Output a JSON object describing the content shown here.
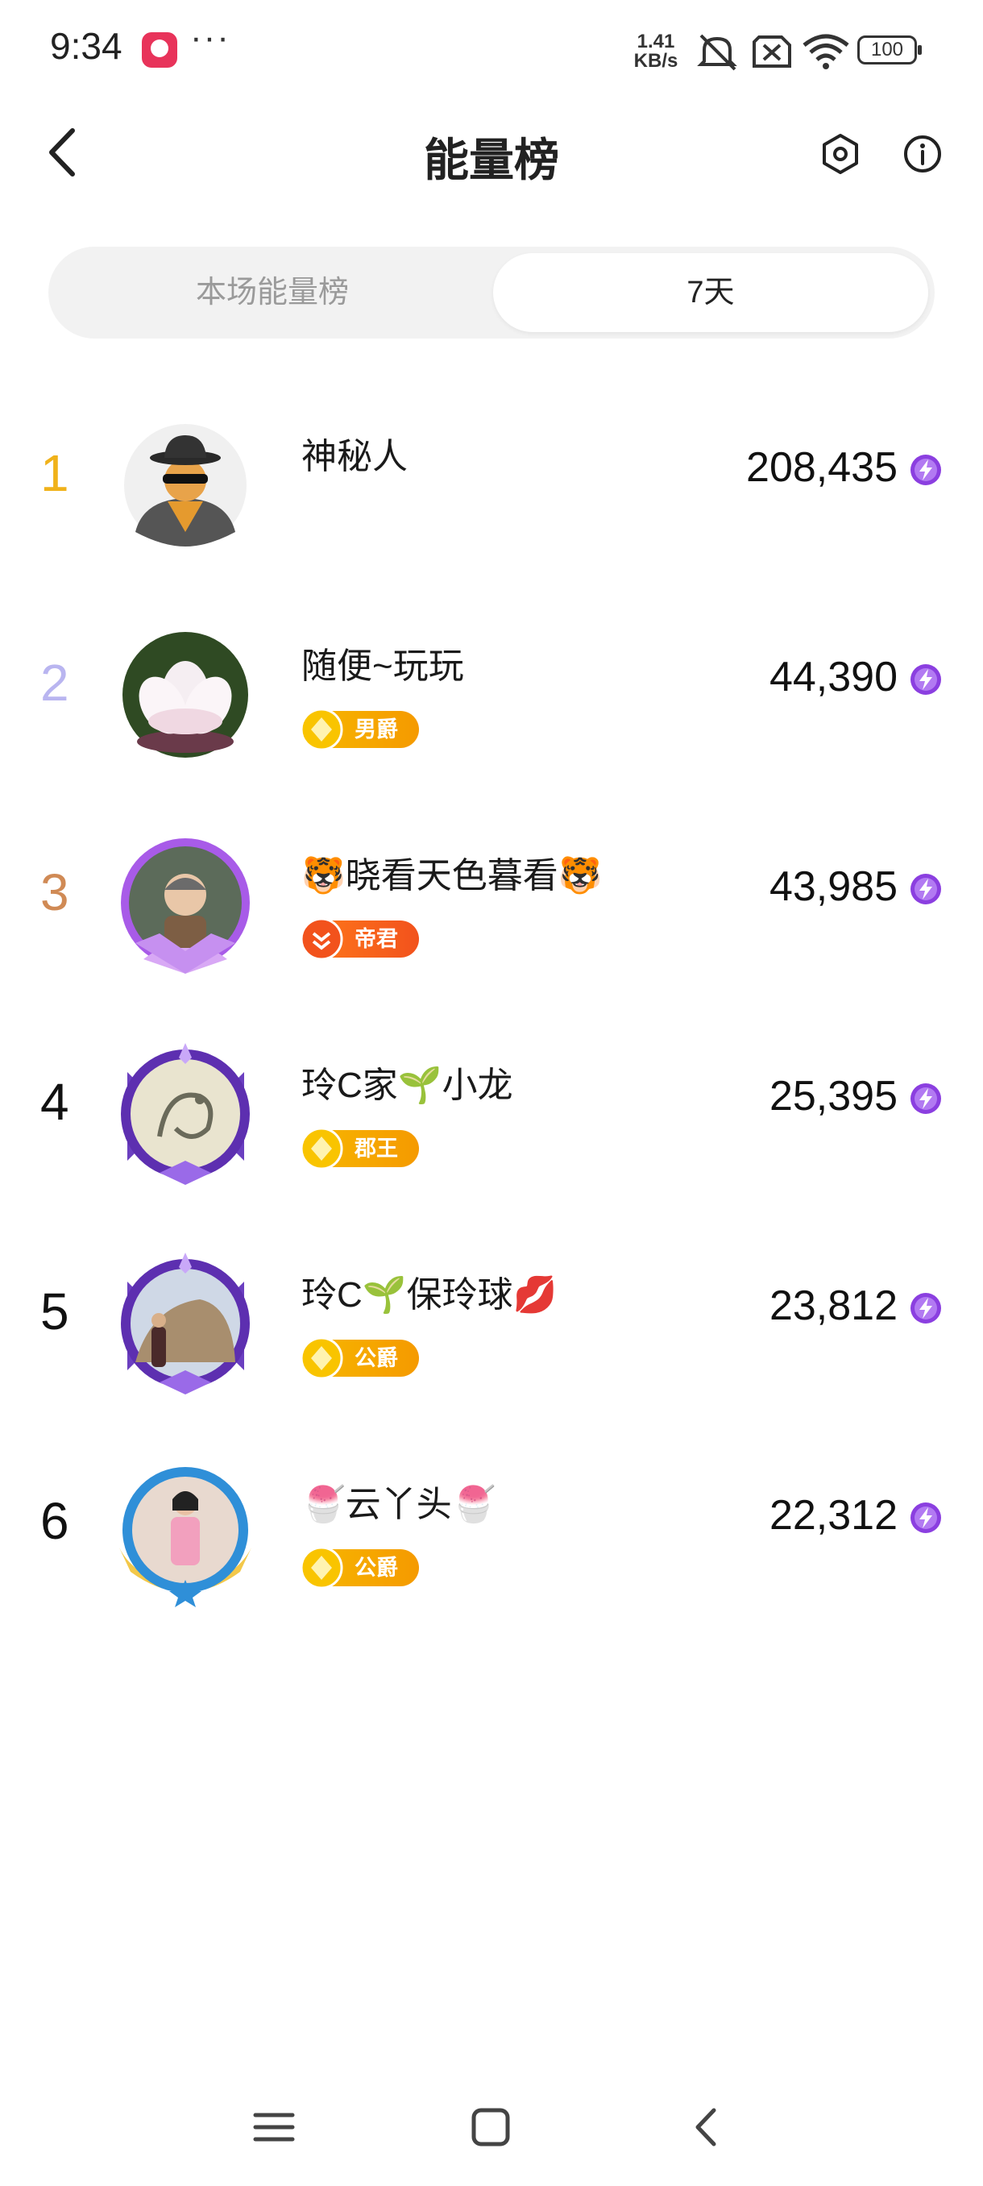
{
  "status_bar": {
    "time": "9:34",
    "more": "···",
    "net_speed_value": "1.41",
    "net_speed_unit": "KB/s",
    "battery": "100"
  },
  "header": {
    "title": "能量榜"
  },
  "tabs": [
    {
      "label": "本场能量榜",
      "selected": false
    },
    {
      "label": "7天",
      "selected": true
    }
  ],
  "ranking": [
    {
      "rank": "1",
      "name": "神秘人",
      "score": "208,435",
      "badge": "",
      "rank_color": "#f0b21a"
    },
    {
      "rank": "2",
      "name": "随便~玩玩",
      "score": "44,390",
      "badge": "男爵",
      "rank_color": "#b9b5f0"
    },
    {
      "rank": "3",
      "name": "🐯晓看天色暮看🐯",
      "score": "43,985",
      "badge": "帝君",
      "rank_color": "#d08a55"
    },
    {
      "rank": "4",
      "name": "玲C家🌱小龙",
      "score": "25,395",
      "badge": "郡王",
      "rank_color": "#111111"
    },
    {
      "rank": "5",
      "name": "玲C🌱保玲球💋",
      "score": "23,812",
      "badge": "公爵",
      "rank_color": "#111111"
    },
    {
      "rank": "6",
      "name": "🍧云丫头🍧",
      "score": "22,312",
      "badge": "公爵",
      "rank_color": "#111111"
    }
  ],
  "icons": {
    "back": "back-arrow-icon",
    "settings": "hexagon-settings-icon",
    "info": "info-icon",
    "energy": "lightning-energy-icon"
  },
  "colors": {
    "accent_purple": "#8b3fe0",
    "badge_gold": "#f5a800",
    "badge_orange": "#f2521c",
    "tab_bg": "#f2f2f2"
  }
}
